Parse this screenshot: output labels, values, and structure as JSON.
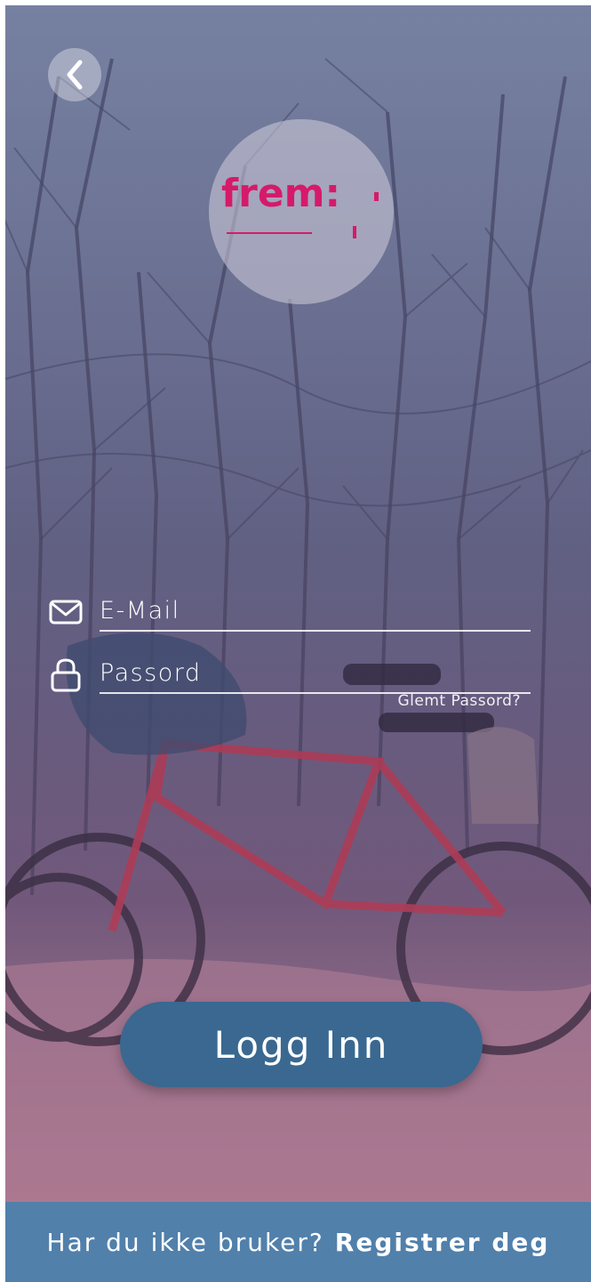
{
  "logo": {
    "text": "frem:"
  },
  "login_form": {
    "email_placeholder": "E-Mail",
    "password_placeholder": "Passord",
    "forgot_password": "Glemt Passord?",
    "login_button": "Logg Inn"
  },
  "footer": {
    "prompt": "Har du ikke bruker?",
    "register_link": "Registrer deg"
  },
  "colors": {
    "brand": "#d61a6a",
    "button": "#3a6890",
    "footer": "#5180ab"
  },
  "icons": {
    "back": "chevron-left-icon",
    "email": "mail-icon",
    "password": "lock-icon"
  }
}
